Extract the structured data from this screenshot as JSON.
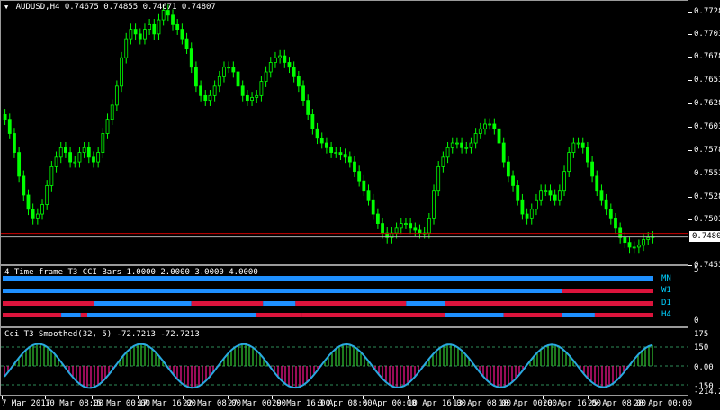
{
  "symbol_header": {
    "symbol": "AUDUSD,H4",
    "open": "0.74675",
    "high": "0.74855",
    "low": "0.74671",
    "close": "0.74807"
  },
  "price_axis": [
    "0.77282",
    "0.77030",
    "0.76782",
    "0.76532",
    "0.76282",
    "0.76030",
    "0.75787",
    "0.75537",
    "0.75282",
    "0.75030",
    "0.74537"
  ],
  "current_price": "0.74807",
  "colors": {
    "bull": "#00ff00",
    "bear": "#00ff00",
    "up_bar": "#1e90ff",
    "down_bar": "#dc143c",
    "cci_line": "#1e90ff",
    "pos_fill": "#32cd32",
    "neg_fill": "#ff1493",
    "level_line": "#2e8b57"
  },
  "bars_indicator": {
    "title": "4 Time frame T3 CCI Bars 1.0000 2.0000 3.0000 4.0000",
    "axis_max": "5",
    "axis_min": "0",
    "rows": [
      {
        "label": "MN",
        "segments": [
          [
            0,
            1,
            "up"
          ]
        ]
      },
      {
        "label": "W1",
        "segments": [
          [
            0,
            0.86,
            "up"
          ],
          [
            0.86,
            1,
            "down"
          ]
        ]
      },
      {
        "label": "D1",
        "segments": [
          [
            0,
            0.14,
            "down"
          ],
          [
            0.14,
            0.29,
            "up"
          ],
          [
            0.29,
            0.4,
            "down"
          ],
          [
            0.4,
            0.45,
            "up"
          ],
          [
            0.45,
            0.62,
            "down"
          ],
          [
            0.62,
            0.68,
            "up"
          ],
          [
            0.68,
            1,
            "down"
          ]
        ]
      },
      {
        "label": "H4",
        "segments": [
          [
            0,
            0.09,
            "down"
          ],
          [
            0.09,
            0.12,
            "up"
          ],
          [
            0.12,
            0.13,
            "down"
          ],
          [
            0.13,
            0.39,
            "up"
          ],
          [
            0.39,
            0.46,
            "down"
          ],
          [
            0.46,
            0.68,
            "down"
          ],
          [
            0.68,
            0.77,
            "up"
          ],
          [
            0.77,
            0.79,
            "down"
          ],
          [
            0.79,
            0.86,
            "down"
          ],
          [
            0.86,
            0.91,
            "up"
          ],
          [
            0.91,
            1,
            "down"
          ]
        ]
      }
    ]
  },
  "cci_indicator": {
    "title": "Cci T3 Smoothed(32, 5) -72.7213 -72.7213",
    "axis": [
      "175",
      "150",
      "0.00",
      "-150",
      "-214.2477"
    ]
  },
  "time_axis": [
    "7 Mar 2017",
    "10 Mar 08:00",
    "15 Mar 00:00",
    "17 Mar 16:00",
    "22 Mar 08:00",
    "27 Mar 00:00",
    "29 Mar 16:00",
    "3 Apr 08:00",
    "6 Apr 00:00",
    "10 Apr 16:00",
    "13 Apr 08:00",
    "18 Apr 00:00",
    "20 Apr 16:00",
    "25 Apr 08:00",
    "28 Apr 00:00"
  ],
  "chart_data": {
    "type": "candlestick",
    "title": "AUDUSD,H4",
    "ylim": [
      0.745,
      0.773
    ],
    "close_series": [
      0.7605,
      0.759,
      0.757,
      0.7545,
      0.7525,
      0.751,
      0.75,
      0.7505,
      0.7515,
      0.7535,
      0.7555,
      0.7565,
      0.7575,
      0.757,
      0.756,
      0.756,
      0.757,
      0.7575,
      0.7565,
      0.756,
      0.757,
      0.759,
      0.7605,
      0.762,
      0.764,
      0.767,
      0.769,
      0.77,
      0.7695,
      0.769,
      0.77,
      0.7705,
      0.7695,
      0.771,
      0.772,
      0.7715,
      0.7705,
      0.77,
      0.769,
      0.768,
      0.766,
      0.764,
      0.763,
      0.7625,
      0.763,
      0.764,
      0.765,
      0.766,
      0.766,
      0.7655,
      0.764,
      0.763,
      0.7625,
      0.7628,
      0.763,
      0.7645,
      0.7655,
      0.7665,
      0.767,
      0.7672,
      0.7665,
      0.766,
      0.765,
      0.764,
      0.7625,
      0.761,
      0.7595,
      0.7585,
      0.758,
      0.7575,
      0.757,
      0.757,
      0.7568,
      0.7565,
      0.756,
      0.755,
      0.754,
      0.753,
      0.752,
      0.7505,
      0.7495,
      0.7485,
      0.748,
      0.7485,
      0.749,
      0.7495,
      0.7495,
      0.749,
      0.7488,
      0.7485,
      0.7485,
      0.75,
      0.753,
      0.7555,
      0.7565,
      0.7575,
      0.758,
      0.758,
      0.7575,
      0.7575,
      0.758,
      0.759,
      0.7595,
      0.76,
      0.76,
      0.7595,
      0.758,
      0.756,
      0.7545,
      0.7535,
      0.752,
      0.7505,
      0.75,
      0.751,
      0.752,
      0.753,
      0.753,
      0.7525,
      0.752,
      0.753,
      0.755,
      0.757,
      0.758,
      0.758,
      0.7575,
      0.756,
      0.7545,
      0.753,
      0.752,
      0.751,
      0.75,
      0.749,
      0.748,
      0.7475,
      0.747,
      0.747,
      0.7472,
      0.7478,
      0.748,
      0.7481
    ]
  }
}
